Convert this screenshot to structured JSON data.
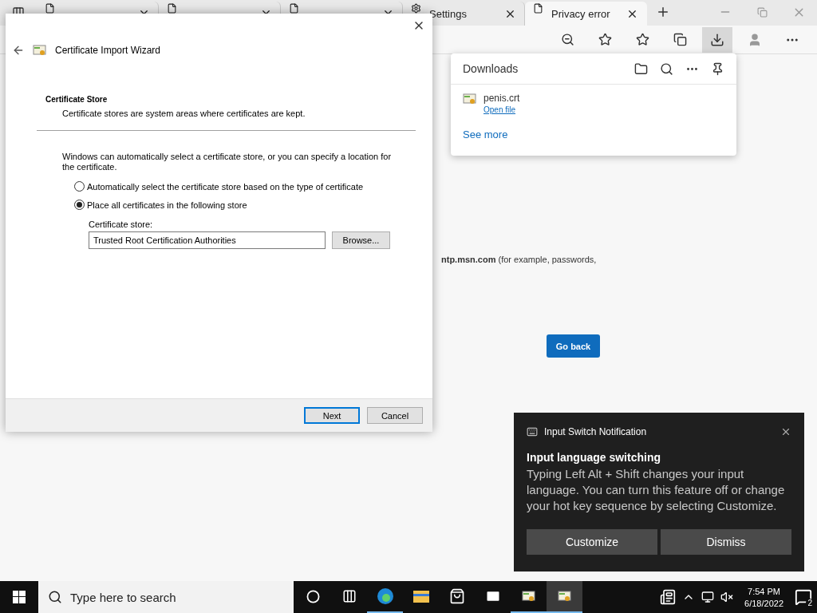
{
  "browser": {
    "tabs": [
      {
        "kind": "page",
        "selected": false
      },
      {
        "kind": "page",
        "selected": false
      },
      {
        "kind": "page",
        "selected": false
      },
      {
        "title": "Settings",
        "kind": "settings",
        "selected": false
      },
      {
        "title": "Privacy error",
        "kind": "error",
        "selected": true
      }
    ],
    "toolbar": [
      {
        "kind": "zoom",
        "selected": false
      },
      {
        "kind": "favorite-add",
        "selected": false
      },
      {
        "kind": "favorites",
        "selected": false
      },
      {
        "kind": "collections",
        "selected": false
      },
      {
        "kind": "downloads",
        "selected": true
      },
      {
        "kind": "profile",
        "selected": false
      },
      {
        "kind": "more",
        "selected": false
      }
    ],
    "page": {
      "text": "**ntp.msn.com** (for example, passwords,",
      "button": "Go back"
    }
  },
  "downloads": {
    "title": "Downloads",
    "items": [
      {
        "name": "penis.crt",
        "action": "Open file"
      }
    ],
    "see_more": "See more"
  },
  "wizard": {
    "title": "Certificate Import Wizard",
    "heading": "Certificate Store",
    "subheading": "Certificate stores are system areas where certificates are kept.",
    "intro": "Windows can automatically select a certificate store, or you can specify a location for the certificate.",
    "options": [
      {
        "label": "Automatically select the certificate store based on the type of certificate",
        "checked": false
      },
      {
        "label": "Place all certificates in the following store",
        "checked": true
      }
    ],
    "store_label": "Certificate store:",
    "store_value": "Trusted Root Certification Authorities",
    "browse": "Browse...",
    "buttons": [
      {
        "label": "Next",
        "default": true
      },
      {
        "label": "Cancel",
        "default": false
      }
    ]
  },
  "notification": {
    "app": "Input Switch Notification",
    "title": "Input language switching",
    "body": "Typing Left Alt + Shift changes your input language. You can turn this feature off or change your hot key sequence by selecting Customize.",
    "buttons": [
      "Customize",
      "Dismiss"
    ]
  },
  "taskbar": {
    "search_placeholder": "Type here to search",
    "apps": [
      {
        "kind": "cortana",
        "running": false,
        "selected": false
      },
      {
        "kind": "taskview",
        "running": false,
        "selected": false
      },
      {
        "kind": "edge",
        "running": true,
        "selected": false
      },
      {
        "kind": "explorer",
        "running": false,
        "selected": false
      },
      {
        "kind": "store",
        "running": false,
        "selected": false
      },
      {
        "kind": "mail",
        "running": false,
        "selected": false
      },
      {
        "kind": "certificate",
        "running": true,
        "selected": false
      },
      {
        "kind": "wizard",
        "running": true,
        "selected": true
      }
    ],
    "time": "7:54 PM",
    "date": "6/18/2022",
    "notifications": "2"
  }
}
